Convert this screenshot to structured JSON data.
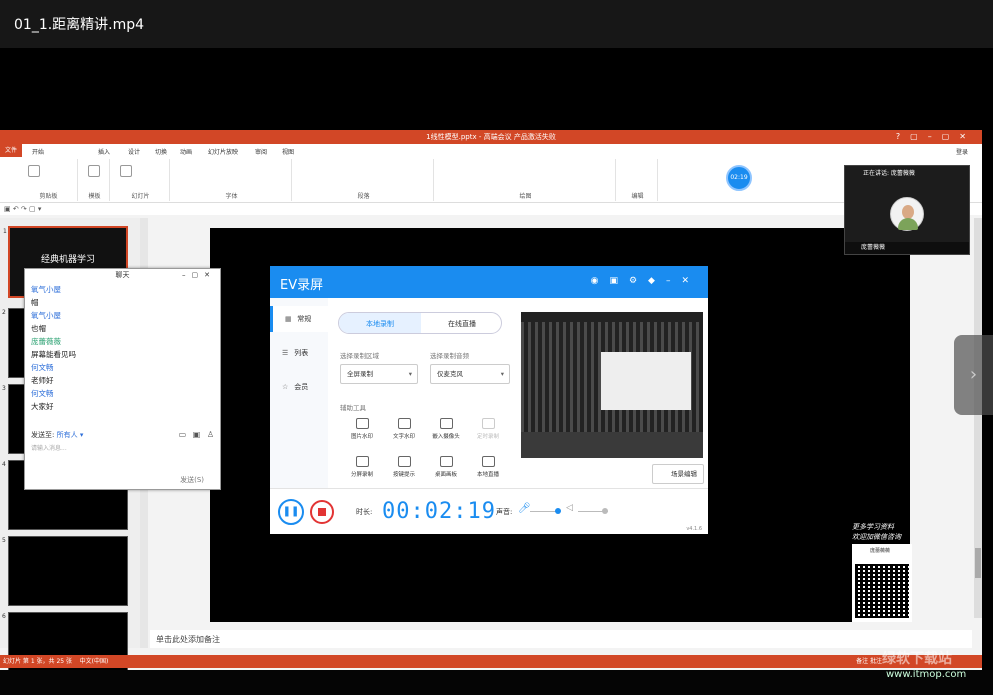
{
  "window": {
    "title": "01_1.距离精讲.mp4"
  },
  "ppt": {
    "title": "1线性模型.pptx - 高端会议 产品激活失败",
    "menu": [
      "文件",
      "开始",
      "插入",
      "设计",
      "切换",
      "动画",
      "幻灯片放映",
      "审阅",
      "视图"
    ],
    "login": "登录",
    "ribbon_groups": [
      "剪贴板",
      "模板",
      "幻灯片",
      "字体",
      "段落",
      "绘图",
      "编辑"
    ],
    "slide1_title": "经典机器学习",
    "notes_placeholder": "单击此处添加备注",
    "status_left": "幻灯片 第 1 张，共 25 张",
    "status_lang": "中文(中国)",
    "status_right": "备注   批注"
  },
  "chat": {
    "title": "聊天",
    "messages": [
      {
        "name": "氧气小屋",
        "text": "帽",
        "color": "blue"
      },
      {
        "name": "氧气小屋",
        "text": "也帽",
        "color": "blue"
      },
      {
        "name": "庞蕾薇薇",
        "text": "屏幕能看见吗",
        "color": "green"
      },
      {
        "name": "何文畅",
        "text": "老师好",
        "color": "blue"
      },
      {
        "name": "何文畅",
        "text": "大家好",
        "color": "blue"
      }
    ],
    "send_to_label": "发送至:",
    "send_to_value": "所有人 ▾",
    "input_placeholder": "请输入消息...",
    "send_button": "发送(S)"
  },
  "ev": {
    "app_name": "EV录屏",
    "sidebar": [
      "常规",
      "列表",
      "会员"
    ],
    "tabs": [
      "本地录制",
      "在线直播"
    ],
    "area_label": "选择录制区域",
    "area_value": "全屏录制",
    "audio_label": "选择录制音频",
    "audio_value": "仅麦克风",
    "tools_label": "辅助工具",
    "tools": [
      "图片水印",
      "文字水印",
      "嵌入摄像头",
      "定时录制",
      "分屏录制",
      "按键提示",
      "桌面画板",
      "本地直播"
    ],
    "scene_button": "场景编辑",
    "time_label": "时长:",
    "timer": "00:02:19",
    "volume_label": "声音:",
    "version": "v4.1.6"
  },
  "camera": {
    "header": "正在讲话: 庞蕾薇薇",
    "footer": "庞蕾薇薇"
  },
  "promo": {
    "line1": "更多学习资料",
    "line2": "欢迎加微信咨询",
    "card_name": "庞蕾薇薇"
  },
  "watermark": {
    "text": "绿软下载站",
    "url": "www.itmop.com"
  },
  "colors": {
    "ppt_accent": "#d24726",
    "ev_blue": "#1a8cf0",
    "stop_red": "#e23434"
  }
}
